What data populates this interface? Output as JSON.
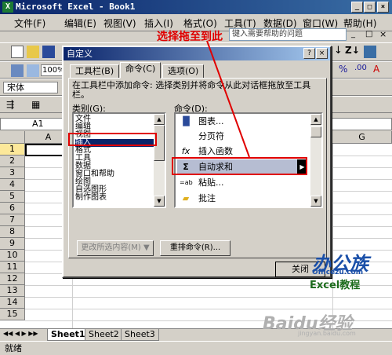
{
  "window": {
    "title": "Microsoft Excel - Book1",
    "min": "_",
    "max": "□",
    "close": "×"
  },
  "menu": {
    "items": [
      "文件(F)",
      "编辑(E)",
      "视图(V)",
      "插入(I)",
      "格式(O)",
      "工具(T)",
      "数据(D)",
      "窗口(W)",
      "帮助(H)"
    ]
  },
  "help_placeholder": "键入需要帮助的问题",
  "toolbar": {
    "zoom": "100%",
    "font": "宋体"
  },
  "namebox": "A1",
  "grid": {
    "columns": [
      "A",
      "G"
    ],
    "rows": [
      "1",
      "2",
      "3",
      "4",
      "5",
      "6",
      "7",
      "8",
      "9",
      "10",
      "11",
      "12",
      "13",
      "14",
      "15"
    ]
  },
  "sheets": [
    "Sheet1",
    "Sheet2",
    "Sheet3"
  ],
  "status": "就绪",
  "dialog": {
    "title": "自定义",
    "help": "?",
    "close": "×",
    "tabs": [
      "工具栏(B)",
      "命令(C)",
      "选项(O)"
    ],
    "description": "在工具栏中添加命令: 选择类别并将命令从此对话框拖放至工具栏。",
    "category_label": "类别(G):",
    "command_label": "命令(D):",
    "categories": [
      "文件",
      "编辑",
      "视图",
      "插入",
      "格式",
      "工具",
      "数据",
      "窗口和帮助",
      "绘图",
      "自选图形",
      "制作图表"
    ],
    "selected_category": "插入",
    "commands": [
      {
        "icon": "chart-icon",
        "label": "图表..."
      },
      {
        "icon": "page-break-icon",
        "label": "分页符"
      },
      {
        "icon": "function-icon",
        "label": "插入函数"
      },
      {
        "icon": "autosum-icon",
        "label": "自动求和"
      },
      {
        "icon": "paste-icon",
        "label": "粘贴..."
      },
      {
        "icon": "comment-icon",
        "label": "批注"
      }
    ],
    "modify_button": "更改所选内容(M) ▼",
    "rearrange_button": "重排命令(R)...",
    "close_button": "关闭"
  },
  "annotation": "选择拖至到此",
  "watermarks": {
    "logo": "办公族",
    "site": "Officezu.com",
    "tagline": "Excel教程",
    "baidu": "Baidu经验",
    "baidu_url": "jingyan.baidu.com"
  },
  "colors": {
    "highlight": "#e00000",
    "title_bar": "#0a246a",
    "selection": "#0a246a"
  }
}
